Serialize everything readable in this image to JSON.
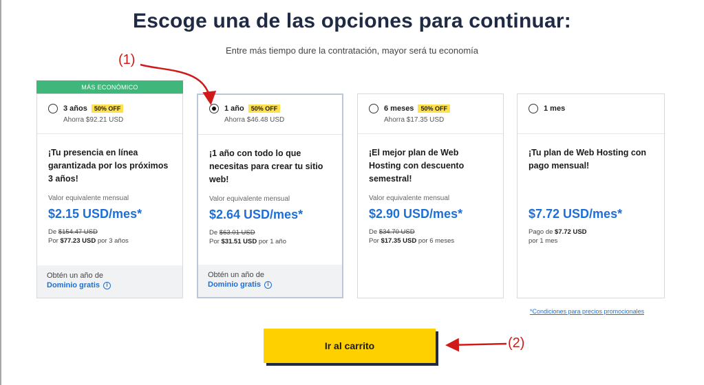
{
  "heading": "Escoge una de las opciones para continuar:",
  "subheading": "Entre más tiempo dure la contratación, mayor será tu economía",
  "ribbon": "MÁS ECONÓMICO",
  "eq_label": "Valor equivalente mensual",
  "plans": [
    {
      "label": "3 años",
      "badge": "50% OFF",
      "saving": "Ahorra $92.21 USD",
      "description": "¡Tu presencia en línea garantizada por los próximos 3 años!",
      "price": "$2.15 USD/mes*",
      "from_prefix": "De ",
      "from_price": "$154.47 USD",
      "total_prefix": "Por ",
      "total_price": "$77.23 USD",
      "total_suffix": " por 3 años",
      "domain_line1": "Obtén un año de",
      "domain_line2": "Dominio gratis"
    },
    {
      "label": "1 año",
      "badge": "50% OFF",
      "saving": "Ahorra $46.48 USD",
      "description": "¡1 año con todo lo que necesitas para crear tu sitio web!",
      "price": "$2.64 USD/mes*",
      "from_prefix": "De ",
      "from_price": "$63.01 USD",
      "total_prefix": "Por ",
      "total_price": "$31.51 USD",
      "total_suffix": " por 1 año",
      "domain_line1": "Obtén un año de",
      "domain_line2": "Dominio gratis"
    },
    {
      "label": "6 meses",
      "badge": "50% OFF",
      "saving": "Ahorra $17.35 USD",
      "description": "¡El mejor plan de Web Hosting con descuento semestral!",
      "price": "$2.90 USD/mes*",
      "from_prefix": "De ",
      "from_price": "$34.70 USD",
      "total_prefix": "Por ",
      "total_price": "$17.35 USD",
      "total_suffix": " por 6 meses"
    },
    {
      "label": "1 mes",
      "description": "¡Tu plan de Web Hosting con pago mensual!",
      "price": "$7.72 USD/mes*",
      "pay_prefix": "Pago de ",
      "pay_price": "$7.72 USD",
      "pay_suffix": "por 1 mes"
    }
  ],
  "selected_plan": "1 año",
  "terms_link": "*Condiciones para precios promocionales",
  "cart_button": "Ir al carrito",
  "annotations": {
    "a1": "(1)",
    "a2": "(2)"
  },
  "colors": {
    "accent_blue": "#1d6fd6",
    "ribbon_green": "#3fb67a",
    "badge_yellow": "#ffe14d",
    "button_yellow": "#ffd000",
    "annotation_red": "#d01a1a"
  }
}
